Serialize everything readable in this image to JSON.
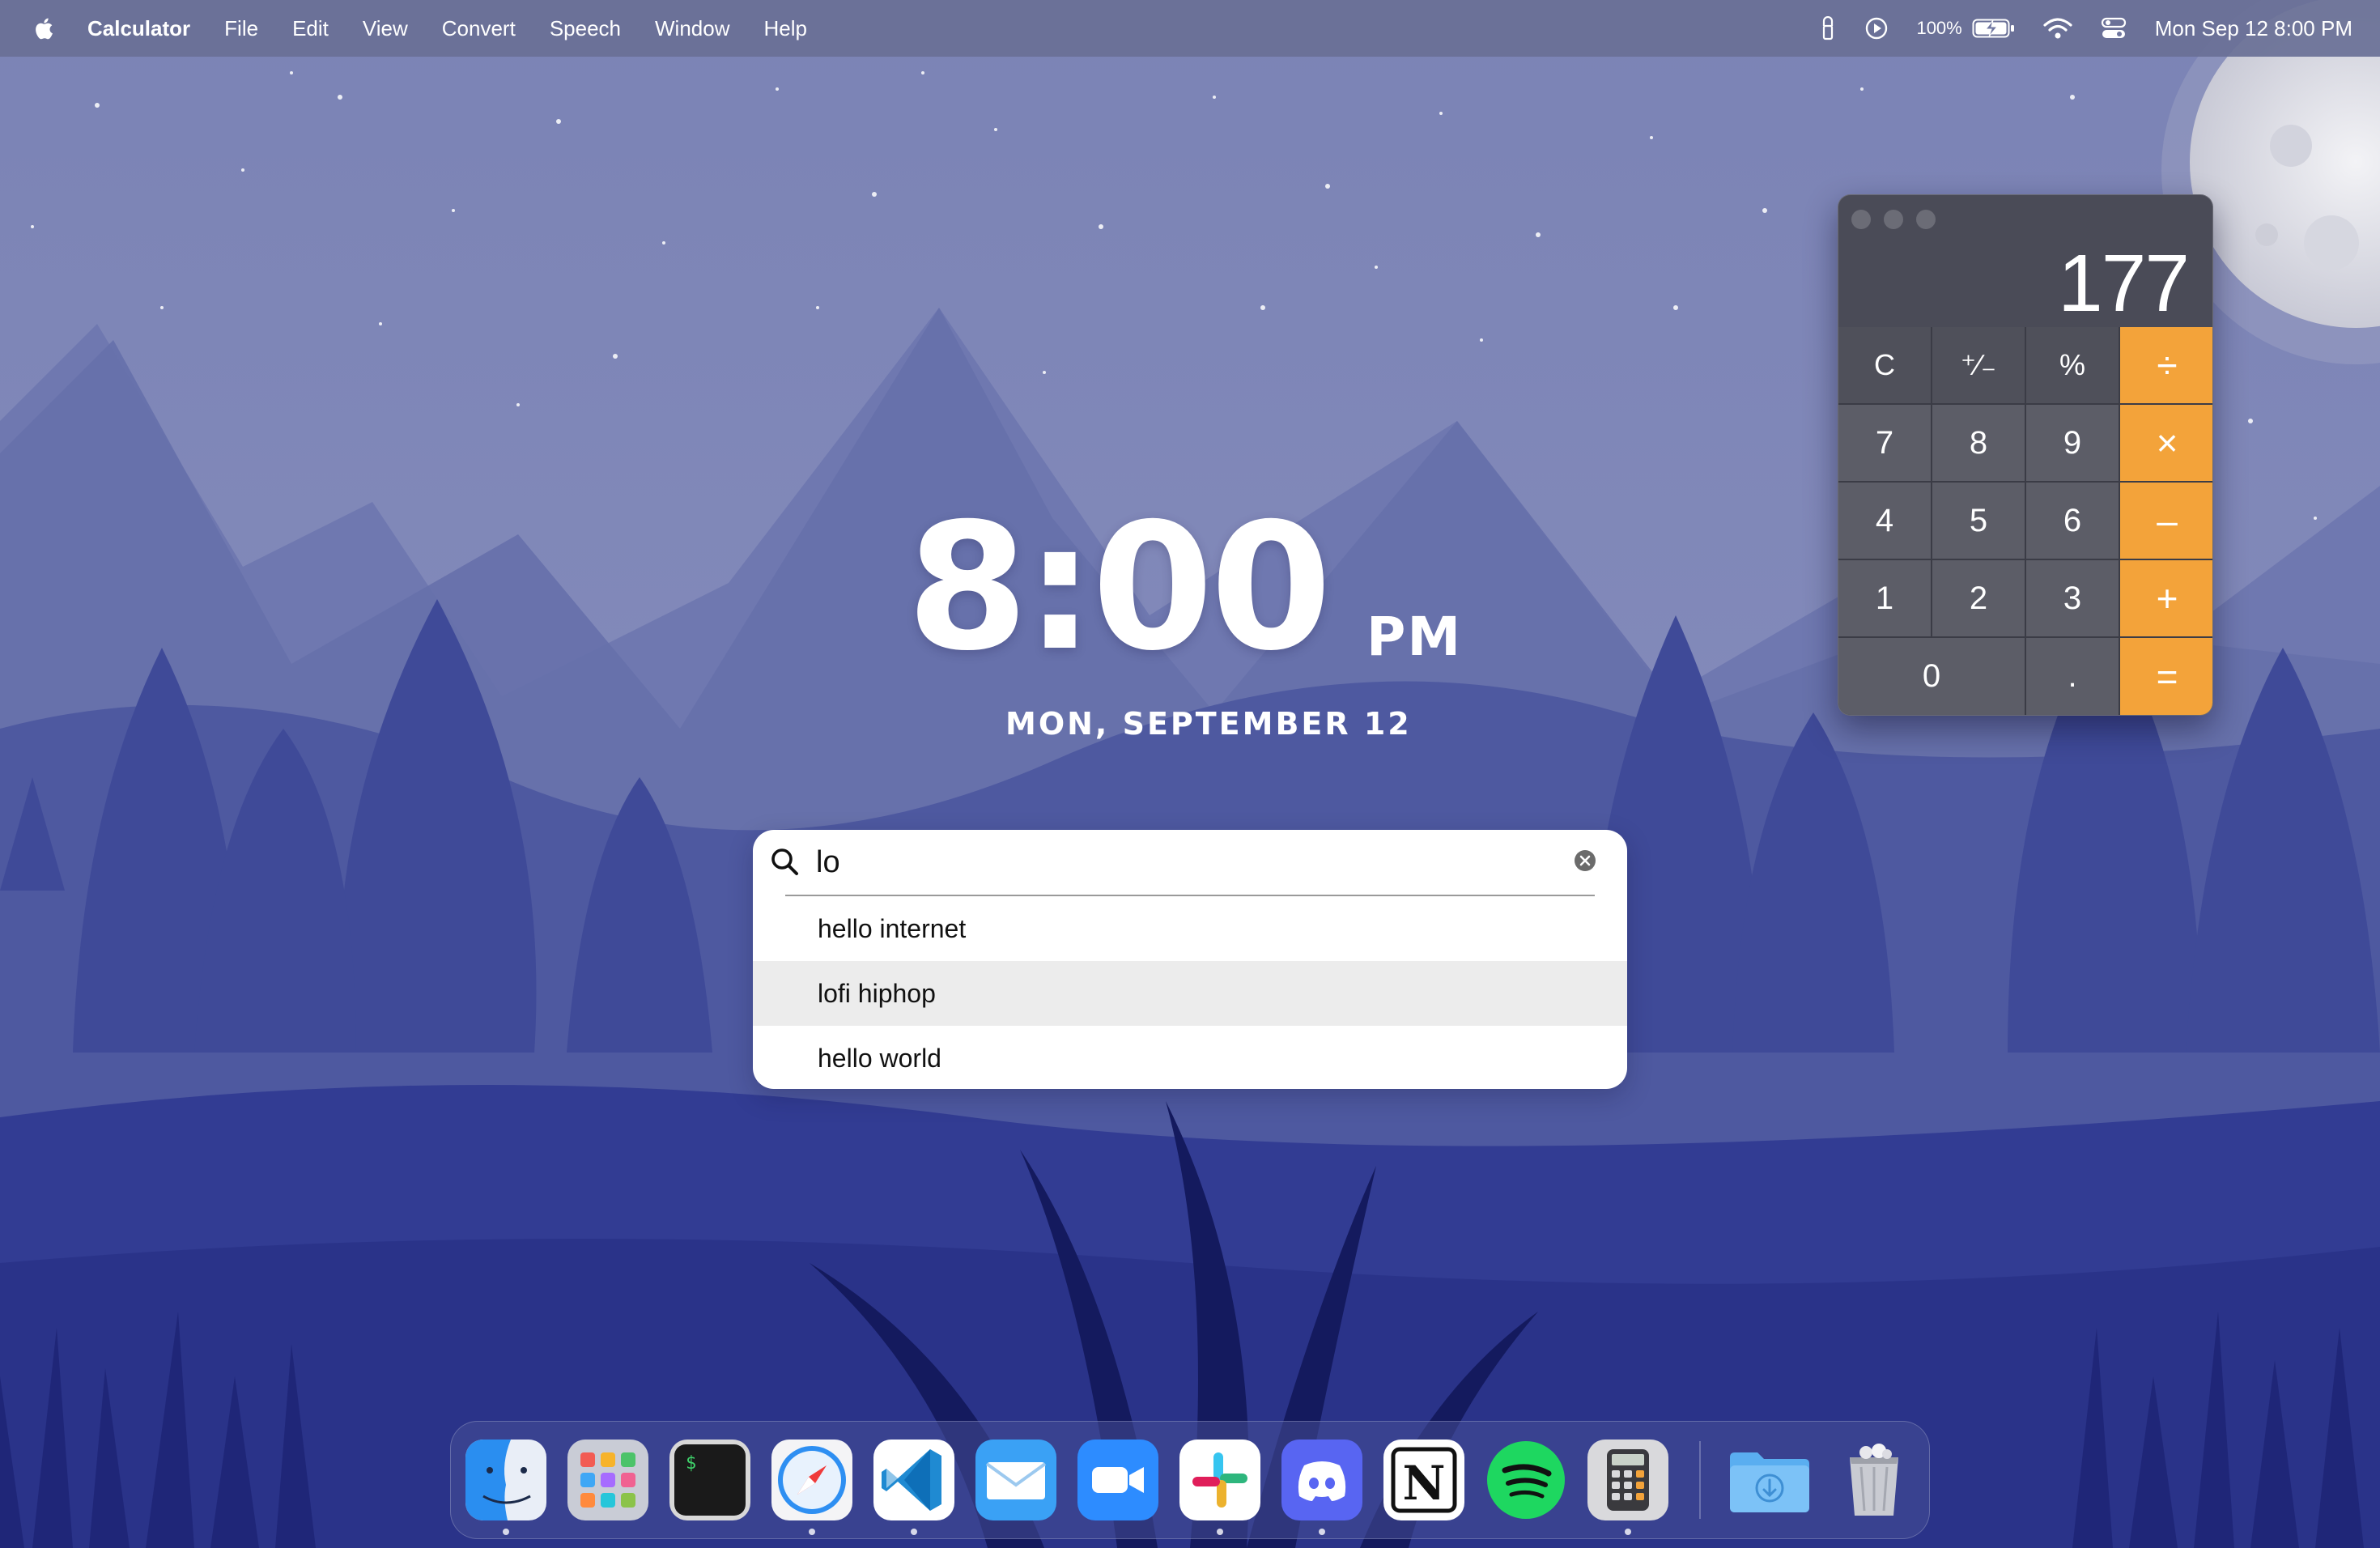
{
  "menubar": {
    "app_name": "Calculator",
    "menus": [
      "File",
      "Edit",
      "View",
      "Convert",
      "Speech",
      "Window",
      "Help"
    ],
    "battery_percent": "100%",
    "datetime": "Mon Sep 12  8:00 PM",
    "status_icons": [
      "touch-bar-icon",
      "play-circle-icon",
      "battery-charging-icon",
      "wifi-icon",
      "control-center-icon"
    ]
  },
  "widget": {
    "time": "8:00",
    "ampm": "PM",
    "date": "MON, SEPTEMBER 12"
  },
  "search": {
    "query": "lo",
    "suggestions": [
      "hello internet",
      "lofi hiphop",
      "hello world"
    ],
    "highlighted_index": 1
  },
  "calculator": {
    "display": "177",
    "keys": [
      "C",
      "⁺∕₋",
      "%",
      "÷",
      "7",
      "8",
      "9",
      "×",
      "4",
      "5",
      "6",
      "–",
      "1",
      "2",
      "3",
      "+",
      "0",
      ".",
      "="
    ],
    "accent_color": "#f3a33a"
  },
  "dock": {
    "apps": [
      "Finder",
      "Launchpad",
      "Terminal",
      "Safari",
      "Visual Studio Code",
      "Mail",
      "Zoom",
      "Slack",
      "Discord",
      "Notion",
      "Spotify",
      "Calculator",
      "Downloads",
      "Trash"
    ],
    "notion_glyph": "N",
    "terminal_prompt": "$"
  },
  "colors": {
    "sky": "#7f87b8",
    "mountain_far": "#6c74ad",
    "forest": "#2f3a8f",
    "ground": "#2a3187"
  }
}
